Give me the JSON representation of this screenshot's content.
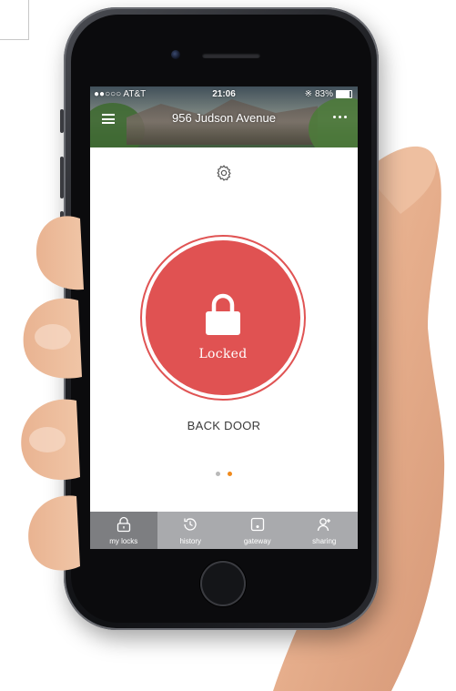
{
  "status_bar": {
    "carrier": "●●○○○ AT&T",
    "time": "21:06",
    "battery": "83%",
    "bluetooth_icon": "bluetooth-icon"
  },
  "header": {
    "title": "956 Judson Avenue",
    "menu_icon": "hamburger-menu-icon",
    "more_icon": "more-dots-icon"
  },
  "settings_icon": "gear-icon",
  "lock": {
    "status": "Locked",
    "name": "BACK DOOR",
    "color": "#e05252"
  },
  "pager": {
    "total": 2,
    "active_index": 1,
    "inactive_color": "#b9b9b9",
    "active_color": "#f08a1c"
  },
  "tabs": [
    {
      "label": "my locks",
      "icon": "lock-icon",
      "active": true
    },
    {
      "label": "history",
      "icon": "history-icon",
      "active": false
    },
    {
      "label": "gateway",
      "icon": "gateway-icon",
      "active": false
    },
    {
      "label": "sharing",
      "icon": "add-user-icon",
      "active": false
    }
  ]
}
